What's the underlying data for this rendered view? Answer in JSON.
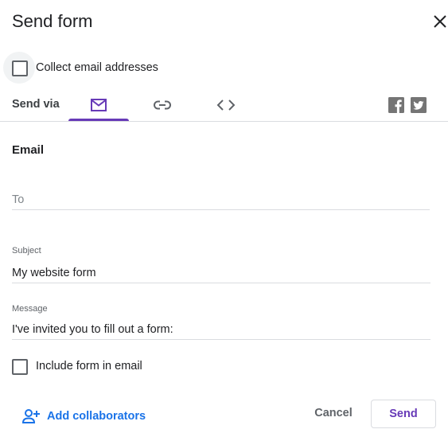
{
  "dialog": {
    "title": "Send form",
    "close_icon": "close-icon"
  },
  "collect_email": {
    "label": "Collect email addresses",
    "checked": false
  },
  "send_via": {
    "label": "Send via",
    "tabs": [
      {
        "id": "email",
        "icon": "mail-icon",
        "selected": true
      },
      {
        "id": "link",
        "icon": "link-icon",
        "selected": false
      },
      {
        "id": "embed",
        "icon": "embed-code-icon",
        "selected": false
      }
    ],
    "share_icons": [
      "facebook-icon",
      "twitter-icon"
    ]
  },
  "email_section": {
    "heading": "Email",
    "to": {
      "placeholder": "To",
      "value": ""
    },
    "subject": {
      "label": "Subject",
      "value": "My website form"
    },
    "message": {
      "label": "Message",
      "value": "I've invited you to fill out a form:"
    },
    "include_form": {
      "label": "Include form in email",
      "checked": false
    }
  },
  "footer": {
    "add_collaborators": "Add collaborators",
    "cancel": "Cancel",
    "send": "Send"
  },
  "colors": {
    "accent": "#673ab7",
    "link": "#1a73e8",
    "divider": "#dadce0"
  }
}
